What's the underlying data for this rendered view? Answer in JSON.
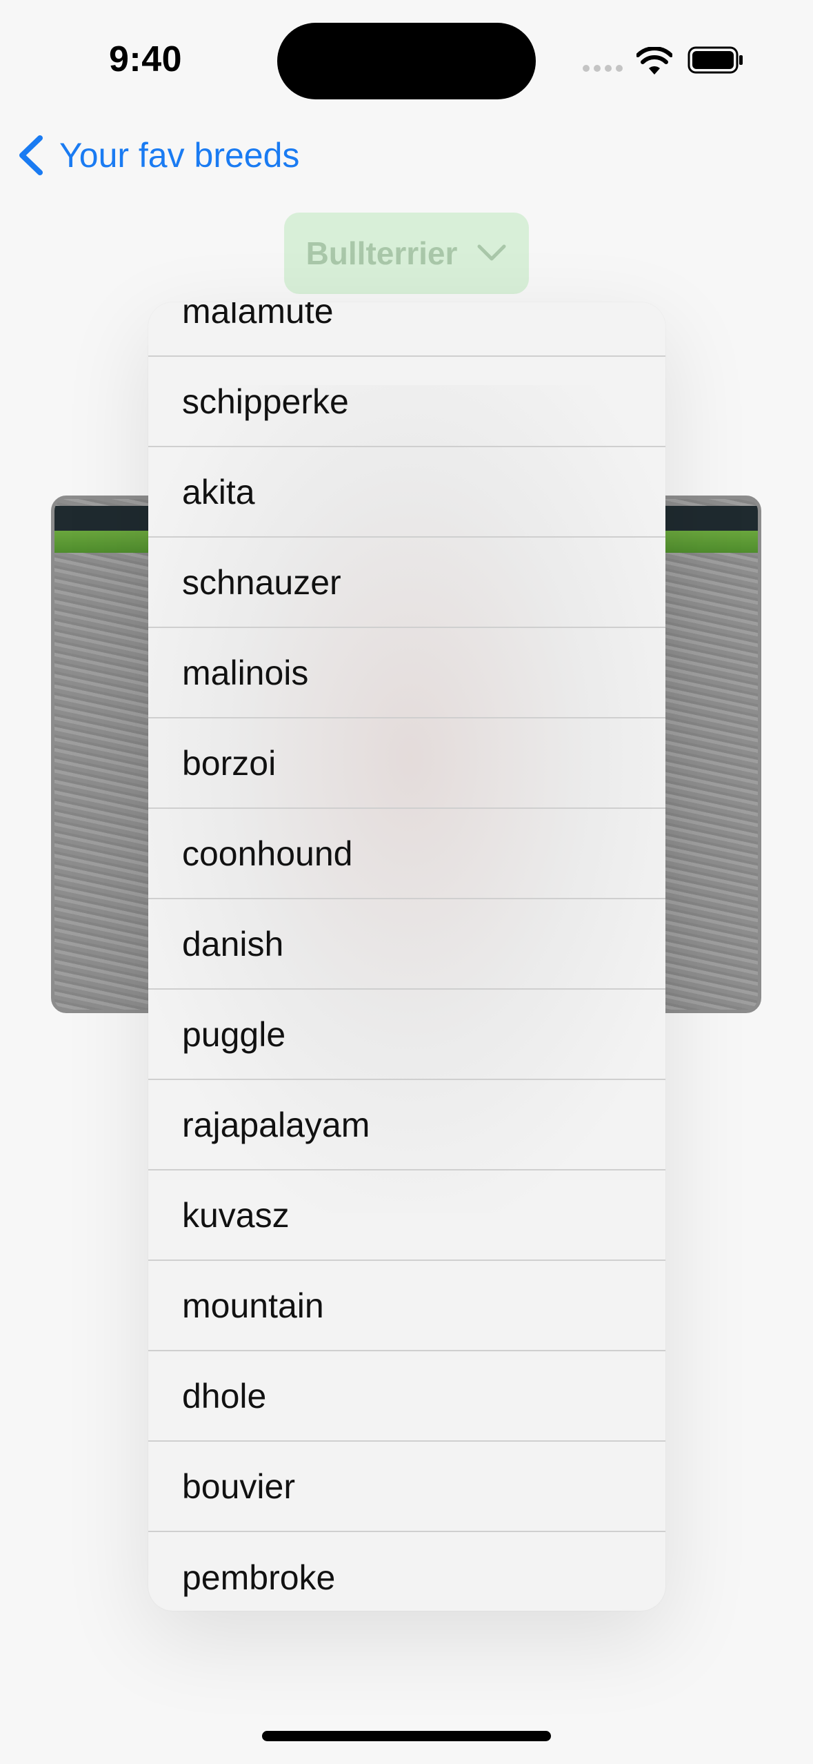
{
  "status_bar": {
    "time": "9:40"
  },
  "nav": {
    "back_label": "Your fav breeds",
    "back_icon": "chevron-left-icon"
  },
  "dropdown": {
    "selected": "Bullterrier",
    "icon": "chevron-down-icon"
  },
  "breed_menu": {
    "items": [
      "malamute",
      "schipperke",
      "akita",
      "schnauzer",
      "malinois",
      "borzoi",
      "coonhound",
      "danish",
      "puggle",
      "rajapalayam",
      "kuvasz",
      "mountain",
      "dhole",
      "bouvier",
      "pembroke"
    ]
  },
  "colors": {
    "accent": "#1a7bf2",
    "dropdown_bg": "#d8efd8",
    "dropdown_text": "#a9c7a9",
    "menu_bg": "#f3f3f3",
    "separator": "#cfcfcf"
  }
}
